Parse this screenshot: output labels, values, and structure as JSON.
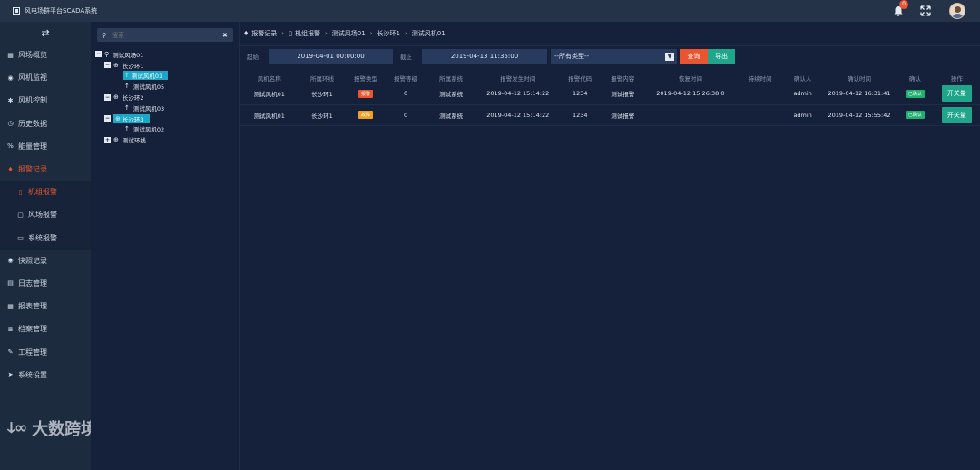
{
  "app": {
    "title": "风电场群平台SCADA系统"
  },
  "topbar": {
    "notification_count": "0"
  },
  "sidebar": {
    "items": [
      {
        "label": "风场概览",
        "icon": "grid-icon"
      },
      {
        "label": "风机监视",
        "icon": "camera-icon"
      },
      {
        "label": "风机控制",
        "icon": "gear-icon"
      },
      {
        "label": "历史数据",
        "icon": "clock-icon"
      },
      {
        "label": "能量管理",
        "icon": "link-icon"
      },
      {
        "label": "报警记录",
        "icon": "bell-icon",
        "active": true
      },
      {
        "label": "快照记录",
        "icon": "camera-icon"
      },
      {
        "label": "日志管理",
        "icon": "document-icon"
      },
      {
        "label": "报表管理",
        "icon": "table-icon"
      },
      {
        "label": "档案管理",
        "icon": "list-icon"
      },
      {
        "label": "工程管理",
        "icon": "wrench-icon"
      },
      {
        "label": "系统设置",
        "icon": "send-icon"
      }
    ],
    "subitems": [
      {
        "label": "机组报警",
        "active": true
      },
      {
        "label": "风场报警"
      },
      {
        "label": "系统报警"
      }
    ],
    "watermark": "大数跨境"
  },
  "tree": {
    "search_placeholder": "搜索",
    "nodes": [
      {
        "label": "测试风场01"
      },
      {
        "label": "长沙环1"
      },
      {
        "label": "测试风机01"
      },
      {
        "label": "测试风机05"
      },
      {
        "label": "长沙环2"
      },
      {
        "label": "测试风机03"
      },
      {
        "label": "长沙环3"
      },
      {
        "label": "测试风机02"
      },
      {
        "label": "测试环线"
      }
    ]
  },
  "breadcrumb": [
    "报警记录",
    "机组报警",
    "测试风场01",
    "长沙环1",
    "测试风机01"
  ],
  "filter": {
    "start_label": "起始",
    "start_value": "2019-04-01 00:00:00",
    "end_label": "截止",
    "end_value": "2019-04-13 11:35:00",
    "type_value": "--所有类型--",
    "query_label": "查询",
    "export_label": "导出"
  },
  "table": {
    "headers": [
      "风机名称",
      "所属环线",
      "报警类型",
      "报警等级",
      "所属系统",
      "报警发生时间",
      "报警代码",
      "报警内容",
      "恢复时间",
      "持续时间",
      "确认人",
      "确认时间",
      "确认",
      "操作"
    ],
    "rows": [
      {
        "name": "测试风机01",
        "line": "长沙环1",
        "type": "报警",
        "type_color": "#e8552f",
        "level": "0",
        "system": "测试系统",
        "time": "2019-04-12 15:14:22",
        "code": "1234",
        "content": "测试报警",
        "recover": "2019-04-12 15:26:38.0",
        "duration": "",
        "confirmer": "admin",
        "confirm_time": "2019-04-12 16:31:41",
        "confirmed": "已确认",
        "action": "开关量"
      },
      {
        "name": "测试风机01",
        "line": "长沙环1",
        "type": "故障",
        "type_color": "#f0a020",
        "level": "0",
        "system": "测试系统",
        "time": "2019-04-12 15:14:22",
        "code": "1234",
        "content": "测试报警",
        "recover": "",
        "duration": "",
        "confirmer": "admin",
        "confirm_time": "2019-04-12 15:55:42",
        "confirmed": "已确认",
        "action": "开关量"
      }
    ]
  }
}
